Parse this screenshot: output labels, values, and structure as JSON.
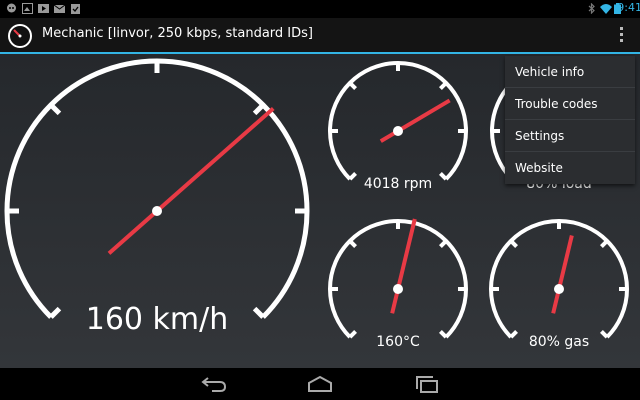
{
  "status_bar": {
    "time": "9:41",
    "icons": [
      "talk-icon",
      "gallery-icon",
      "play-icon",
      "mail-icon",
      "clipboard-icon",
      "bluetooth-icon",
      "wifi-icon",
      "battery-icon"
    ]
  },
  "action_bar": {
    "title": "Mechanic [linvor, 250 kbps, standard IDs]",
    "app_icon": "gauge-icon",
    "overflow_icon": "overflow-menu-icon"
  },
  "gauges": [
    {
      "id": "speed",
      "label": "160 km/h",
      "needle_fraction": 0.68
    },
    {
      "id": "rpm",
      "label": "4018 rpm",
      "needle_fraction": 0.72
    },
    {
      "id": "load",
      "label": "80% load",
      "needle_fraction": 0.8
    },
    {
      "id": "temp",
      "label": "160°C",
      "needle_fraction": 0.55
    },
    {
      "id": "gas",
      "label": "80% gas",
      "needle_fraction": 0.55
    }
  ],
  "menu": {
    "items": [
      "Vehicle info",
      "Trouble codes",
      "Settings",
      "Website"
    ]
  },
  "nav_bar": {
    "icons": [
      "back-icon",
      "home-icon",
      "recents-icon"
    ]
  },
  "colors": {
    "accent": "#33b5e5",
    "needle": "#e83a45",
    "dial": "#ffffff"
  }
}
